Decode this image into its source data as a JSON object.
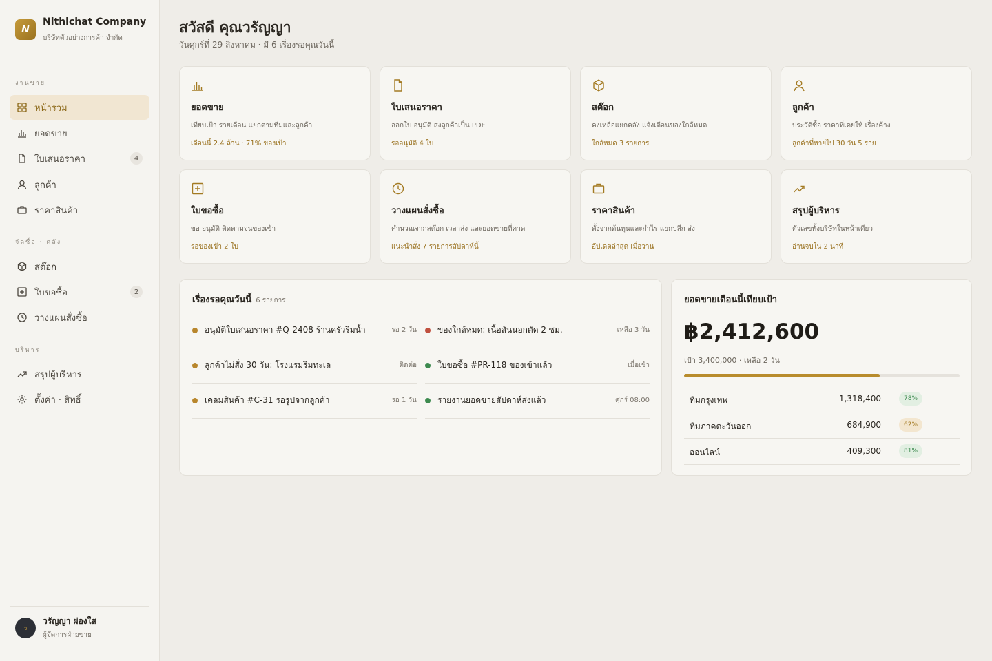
{
  "company": {
    "logo_letter": "N",
    "name": "Nithichat Company",
    "subtitle": "บริษัทตัวอย่างการค้า จำกัด"
  },
  "sidebar": {
    "sections": [
      {
        "label": "งานขาย"
      },
      {
        "label": "จัดซื้อ · คลัง"
      },
      {
        "label": "บริหาร"
      }
    ],
    "items": [
      {
        "label": "หน้ารวม",
        "icon": "grid-icon",
        "active": true
      },
      {
        "label": "ยอดขาย",
        "icon": "bar-chart-icon"
      },
      {
        "label": "ใบเสนอราคา",
        "icon": "document-icon",
        "badge": "4"
      },
      {
        "label": "ลูกค้า",
        "icon": "user-icon"
      },
      {
        "label": "ราคาสินค้า",
        "icon": "briefcase-icon"
      },
      {
        "label": "สต๊อก",
        "icon": "box-icon"
      },
      {
        "label": "ใบขอซื้อ",
        "icon": "plus-square-icon",
        "badge": "2"
      },
      {
        "label": "วางแผนสั่งซื้อ",
        "icon": "clock-icon"
      },
      {
        "label": "สรุปผู้บริหาร",
        "icon": "trend-icon"
      },
      {
        "label": "ตั้งค่า · สิทธิ์",
        "icon": "gear-icon"
      }
    ]
  },
  "user": {
    "avatar": "ว",
    "name": "วรัญญา ผ่องใส",
    "role": "ผู้จัดการฝ่ายขาย"
  },
  "header": {
    "greeting": "สวัสดี คุณวรัญญา",
    "subtitle": "วันศุกร์ที่ 29 สิงหาคม · มี 6 เรื่องรอคุณวันนี้"
  },
  "cards": [
    {
      "icon": "bar-chart-icon",
      "title": "ยอดขาย",
      "desc": "เทียบเป้า รายเดือน แยกตามทีมและลูกค้า",
      "note": "เดือนนี้ 2.4 ล้าน · 71% ของเป้า"
    },
    {
      "icon": "document-icon",
      "title": "ใบเสนอราคา",
      "desc": "ออกใบ อนุมัติ ส่งลูกค้าเป็น PDF",
      "note": "รออนุมัติ 4 ใบ"
    },
    {
      "icon": "box-icon",
      "title": "สต๊อก",
      "desc": "คงเหลือแยกคลัง แจ้งเตือนของใกล้หมด",
      "note": "ใกล้หมด 3 รายการ"
    },
    {
      "icon": "user-icon",
      "title": "ลูกค้า",
      "desc": "ประวัติซื้อ ราคาที่เคยให้ เรื่องค้าง",
      "note": "ลูกค้าที่หายไป 30 วัน 5 ราย"
    },
    {
      "icon": "plus-square-icon",
      "title": "ใบขอซื้อ",
      "desc": "ขอ อนุมัติ ติดตามจนของเข้า",
      "note": "รอของเข้า 2 ใบ"
    },
    {
      "icon": "clock-icon",
      "title": "วางแผนสั่งซื้อ",
      "desc": "คำนวณจากสต๊อก เวลาส่ง และยอดขายที่คาด",
      "note": "แนะนำสั่ง 7 รายการสัปดาห์นี้"
    },
    {
      "icon": "briefcase-icon",
      "title": "ราคาสินค้า",
      "desc": "ตั้งจากต้นทุนและกำไร แยกปลีก ส่ง",
      "note": "อัปเดตล่าสุด เมื่อวาน"
    },
    {
      "icon": "trend-icon",
      "title": "สรุปผู้บริหาร",
      "desc": "ตัวเลขทั้งบริษัทในหน้าเดียว",
      "note": "อ่านจบใน 2 นาที"
    }
  ],
  "tasks_panel": {
    "title": "เรื่องรอคุณวันนี้",
    "count": "6 รายการ",
    "tasks": [
      {
        "text": "อนุมัติใบเสนอราคา #Q-2408 ร้านครัวริมน้ำ",
        "meta": "รอ 2 วัน",
        "color": "#b8862c"
      },
      {
        "text": "ของใกล้หมด: เนื้อสันนอกตัด 2 ซม.",
        "meta": "เหลือ 3 วัน",
        "color": "#c0503f"
      },
      {
        "text": "ลูกค้าไม่สั่ง 30 วัน: โรงแรมริมทะเล",
        "meta": "ติดต่อ",
        "color": "#b8862c"
      },
      {
        "text": "ใบขอซื้อ #PR-118 ของเข้าแล้ว",
        "meta": "เมื่อเช้า",
        "color": "#3d8a4f"
      },
      {
        "text": "เคลมสินค้า #C-31 รอรูปจากลูกค้า",
        "meta": "รอ 1 วัน",
        "color": "#b8862c"
      },
      {
        "text": "รายงานยอดขายสัปดาห์ส่งแล้ว",
        "meta": "ศุกร์ 08:00",
        "color": "#3d8a4f"
      }
    ]
  },
  "sales_panel": {
    "title": "ยอดขายเดือนนี้เทียบเป้า",
    "amount": "฿2,412,600",
    "target_line": "เป้า 3,400,000 · เหลือ 2 วัน",
    "progress": 0.71,
    "teams": [
      {
        "name": "ทีมกรุงเทพ",
        "value": "1,318,400",
        "pct": "78%",
        "pct_bg": "#e2efe2",
        "pct_color": "#3d8a4f"
      },
      {
        "name": "ทีมภาคตะวันออก",
        "value": "684,900",
        "pct": "62%",
        "pct_bg": "#f3e6cf",
        "pct_color": "#a37a22"
      },
      {
        "name": "ออนไลน์",
        "value": "409,300",
        "pct": "81%",
        "pct_bg": "#e2efe2",
        "pct_color": "#3d8a4f"
      }
    ]
  }
}
